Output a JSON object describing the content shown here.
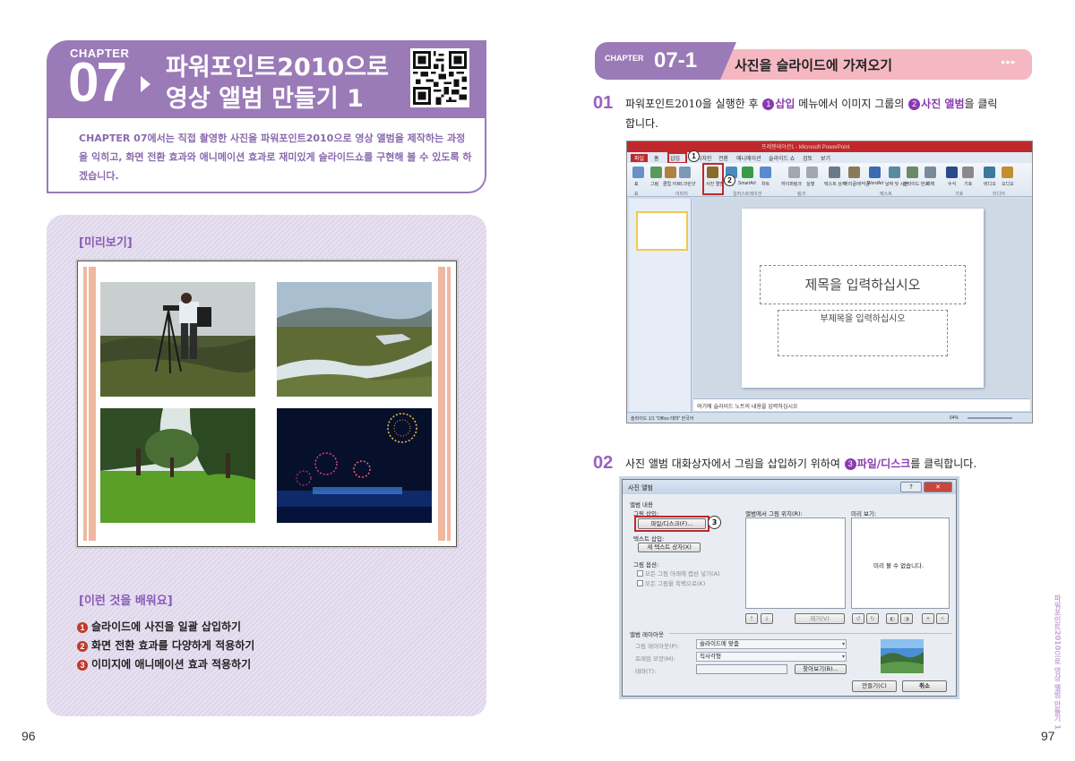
{
  "left_page": {
    "chapter_label": "CHAPTER",
    "chapter_number": "07",
    "chapter_title_line1": "파워포인트2010으로",
    "chapter_title_line2": "영상 앨범 만들기 1",
    "intro": "CHAPTER 07에서는 직접 촬영한 사진을 파워포인트2010으로 영상 앨범을 제작하는 과정을 익히고, 화면 전환 효과와 애니메이션 효과로 재미있게 슬라이드쇼를 구현해 볼 수 있도록 하겠습니다.",
    "preview_label": "[미리보기]",
    "learn_label": "[이런 것을 배워요]",
    "learn_items": [
      {
        "num": "1",
        "text": "슬라이드에 사진을 일괄 삽입하기"
      },
      {
        "num": "2",
        "text": "화면 전환 효과를 다양하게 적용하기"
      },
      {
        "num": "3",
        "text": "이미지에 애니메이션 효과 적용하기"
      }
    ],
    "page_number": "96"
  },
  "right_page": {
    "section_label": "CHAPTER",
    "section_number": "07-1",
    "section_title": "사진을 슬라이드에 가져오기",
    "section_arrows": "▸▸▸",
    "step1": {
      "num": "01",
      "text_a": "파워포인트2010을 실행한 후 ",
      "c1": "1",
      "b1": "삽입",
      "text_b": " 메뉴에서 이미지 그룹의 ",
      "c2": "2",
      "b2": "사진 앨범",
      "text_c": "을 클릭",
      "text_d": "합니다."
    },
    "step2": {
      "num": "02",
      "text_a": "사진 앨범 대화상자에서 그림을 삽입하기 위하여 ",
      "c3": "3",
      "b3": "파일/디스크",
      "text_b": "를 클릭합니다."
    },
    "page_number": "97",
    "side_tab": "파워포인트2010으로 영상 앨범 만들기 1"
  },
  "ppt": {
    "tabs": [
      "파일",
      "홈",
      "삽입",
      "디자인",
      "전환",
      "애니메이션",
      "슬라이드 쇼",
      "검토",
      "보기"
    ],
    "ribbon_items": [
      "표",
      "그림",
      "클립 아트",
      "스크린샷",
      "사진 앨범",
      "도형",
      "SmartArt",
      "차트",
      "하이퍼링크",
      "실행",
      "텍스트 상자",
      "머리글/바닥글",
      "WordArt",
      "날짜 및 시간",
      "슬라이드 번호",
      "개체",
      "수식",
      "기호",
      "비디오",
      "오디오"
    ],
    "groups": [
      "표",
      "이미지",
      "일러스트레이션",
      "링크",
      "텍스트",
      "기호",
      "미디어"
    ],
    "callout1": "1",
    "callout2": "2",
    "title_placeholder": "제목을 입력하십시오",
    "subtitle_placeholder": "부제목을 입력하십시오",
    "notes_placeholder": "여기에 슬라이드 노트의 내용을 입력하십시오",
    "status_left": "슬라이드 1/1   \"Office 테마\"   한국어",
    "status_zoom": "64%"
  },
  "dialog": {
    "title": "사진 앨범",
    "album_content": "앨범 내용",
    "insert_picture": "그림 삽입:",
    "file_disk": "파일/디스크(F)...",
    "callout3": "3",
    "insert_text": "텍스트 삽입:",
    "new_textbox": "새 텍스트 상자(X)",
    "picture_options": "그림 옵션:",
    "opt1": "모든 그림 아래에 캡션 넣기(A)",
    "opt2": "모든 그림을 흑백으로(K)",
    "pictures_in_album": "앨범에서 그림 위치(R):",
    "preview": "미리 보기:",
    "no_preview": "미리 볼 수 없습니다.",
    "remove": "제거(V)",
    "album_layout": "앨범 레이아웃",
    "picture_layout": "그림 레이아웃(P):",
    "picture_layout_value": "슬라이드에 맞춤",
    "frame_shape": "프레임 모양(M):",
    "frame_shape_value": "직사각형",
    "theme": "테마(T):",
    "browse": "찾아보기(B)...",
    "create": "만들기(C)",
    "cancel": "취소"
  },
  "colors": {
    "purple": "#9b7ab8",
    "pink": "#f5b8c2",
    "red": "#c0282b"
  }
}
